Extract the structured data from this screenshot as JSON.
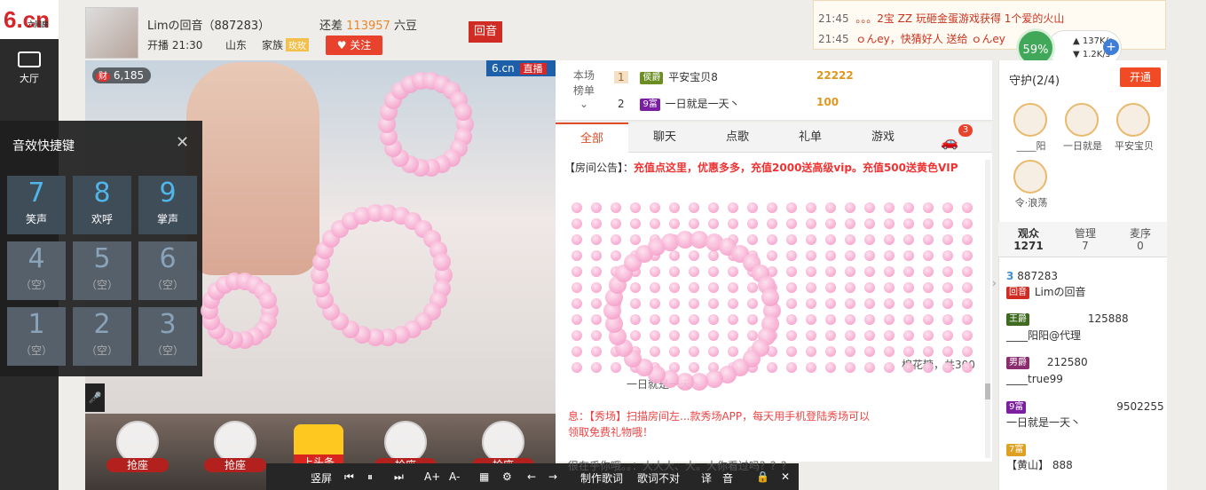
{
  "nav": {
    "logo": "6.cn",
    "logo_sub": "六间房",
    "hall_label": "大厅"
  },
  "room": {
    "avatar_name": "avatar",
    "host_name": "Limの回音（887283）",
    "gap_label": "还差",
    "gap_value": "113957",
    "gap_unit": "六豆",
    "start_time": "开播 21:30",
    "location": "山东",
    "family_label": "家族",
    "family_badge": "玫玫",
    "follow_label": "关注",
    "echo_label": "回音"
  },
  "video": {
    "coin_count": "6,185",
    "site": "6.cn",
    "live_label": "直播",
    "seats": [
      "抢座",
      "抢座",
      "抢座",
      "抢座"
    ],
    "toutiao": "上头条"
  },
  "controls": {
    "items": [
      "竖屏",
      "制作歌词",
      "歌词不对",
      "译",
      "音"
    ]
  },
  "hotkeys": {
    "title": "音效快捷键",
    "keys": [
      {
        "n": "7",
        "l": "笑声",
        "active": true
      },
      {
        "n": "8",
        "l": "欢呼",
        "active": true
      },
      {
        "n": "9",
        "l": "掌声",
        "active": true
      },
      {
        "n": "4",
        "l": "（空）"
      },
      {
        "n": "5",
        "l": "（空）"
      },
      {
        "n": "6",
        "l": "（空）"
      },
      {
        "n": "1",
        "l": "（空）"
      },
      {
        "n": "2",
        "l": "（空）"
      },
      {
        "n": "3",
        "l": "（空）"
      }
    ]
  },
  "rank": {
    "label1": "本场",
    "label2": "榜单",
    "rows": [
      {
        "rank": "1",
        "badge": "侯爵",
        "name": "平安宝贝8",
        "amount": "22222"
      },
      {
        "rank": "2",
        "badge": "9富",
        "name": "一日就是一天丶",
        "amount": "100"
      }
    ]
  },
  "tabs": [
    "全部",
    "聊天",
    "点歌",
    "礼单",
    "游戏"
  ],
  "tab_badge": "3",
  "chat": {
    "notice_label": "【房间公告】：",
    "notice_text": "充值点这里，优惠多多，充值2000送高级vip。充值500送黄色VIP",
    "gift_line": "棉花糖，共300",
    "line1": "一日就是一天丶",
    "line2": "息：【秀场】扫描房间左...款秀场APP，每天用手机登陆秀场可以",
    "line3": "领取免费礼物哦！",
    "line4": "很在乎你哦。。：大大大、大。大你看过吗？？？"
  },
  "top_messages": [
    {
      "time": "21:45",
      "text": "。。。2宝 ZZ 玩砸金蛋游戏获得 1个爱的火山"
    },
    {
      "time": "21:45",
      "text": "ｏんey，快猜好人 送给 ｏんey"
    }
  ],
  "net": {
    "percent": "59%",
    "up": "137K/s",
    "down": "1.2K/s"
  },
  "guard": {
    "title": "守护(2/4)",
    "open_label": "开通",
    "members": [
      "____阳",
      "一日就是",
      "平安宝贝",
      "令·浪荡"
    ]
  },
  "viewers": {
    "tabs": [
      {
        "label": "观众",
        "count": "1271"
      },
      {
        "label": "管理",
        "count": "7"
      },
      {
        "label": "麦序",
        "count": "0"
      }
    ],
    "rows": [
      {
        "badge": "3",
        "id": "887283",
        "name": "Limの回音",
        "tag": "回音"
      },
      {
        "badge": "王爵",
        "id": "125888",
        "name": "____阳阳@代理"
      },
      {
        "badge": "男爵",
        "id": "212580",
        "name": "____true99"
      },
      {
        "badge": "9富",
        "id": "9502255",
        "name": "一日就是一天丶"
      },
      {
        "badge": "7富",
        "id": "888",
        "name": "【黄山】"
      }
    ]
  }
}
